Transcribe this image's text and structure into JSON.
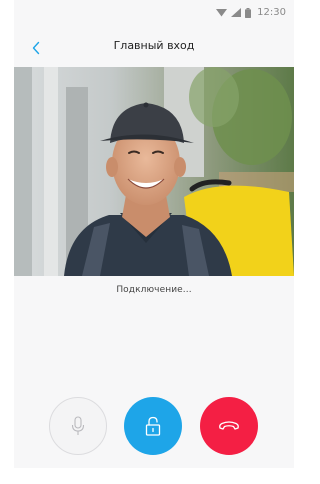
{
  "status_bar": {
    "time": "12:30",
    "icons": [
      "wifi-icon",
      "signal-icon",
      "battery-icon"
    ]
  },
  "header": {
    "title": "Главный вход",
    "back_icon": "chevron-left-icon"
  },
  "video": {
    "description_icon": "camera-feed"
  },
  "call": {
    "status": "Подключение..."
  },
  "controls": {
    "mute_icon": "microphone-icon",
    "unlock_icon": "lock-icon",
    "hangup_icon": "hang-up-icon"
  },
  "colors": {
    "accent": "#1ea5e8",
    "hangup": "#f41f44",
    "muted_button": "#f4f4f5",
    "background": "#f7f7f8"
  }
}
